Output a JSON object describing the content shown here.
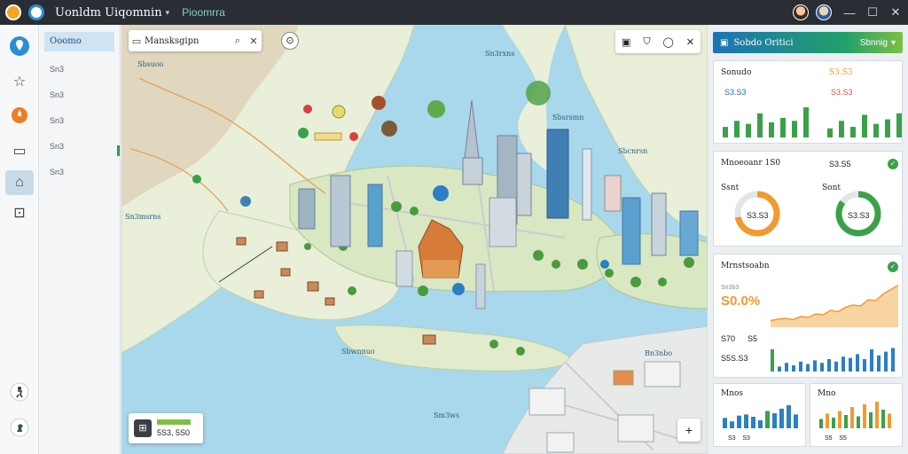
{
  "titlebar": {
    "app_title": "Uonldm Uiqomnin",
    "caret": "▾",
    "subtitle": "Pioomrra",
    "minimize": "—",
    "maximize": "☐",
    "close": "✕"
  },
  "sidebar": {
    "header": "Ooomo",
    "items": [
      "Sn3",
      "Sn3",
      "Sn3",
      "Sn3",
      "Sn3"
    ],
    "rail_icons": [
      "map-pin-icon",
      "star-icon",
      "flame-icon",
      "message-icon",
      "home-icon",
      "chart-icon",
      "person-icon",
      "chess-icon"
    ]
  },
  "map": {
    "search_value": "Mansksgipn",
    "search_icon": "⌕",
    "search_close": "✕",
    "compass": "⊙",
    "tools": [
      "▣",
      "⛉",
      "◯",
      "✕"
    ],
    "info_card_value": "5S3, 5S0",
    "zoom_symbol": "+",
    "labels": [
      "Sbsuoo",
      "Sn3rxns",
      "Sbsrsmn",
      "Sbcnrsn",
      "Sn3msrns",
      "Sbwnnuo",
      "Bn3nbo",
      "Sm3ws"
    ]
  },
  "panel": {
    "header_title": "Sobdo Oritici",
    "header_right": "Sbnnig",
    "card1": {
      "title_left": "Sonudo",
      "value_left": "S3.S3",
      "title_right": "S3.S3",
      "value_right": "S3.S3",
      "bars_left": [
        0.35,
        0.55,
        0.45,
        0.8,
        0.5,
        0.65,
        0.55,
        1.0
      ],
      "bars_right": [
        0.3,
        0.55,
        0.35,
        0.75,
        0.45,
        0.6,
        0.8,
        0.7
      ]
    },
    "card2": {
      "title": "Mnoeoanr 1S0",
      "value": "S3.S5",
      "donut1_label": "Ssnt",
      "donut1_value": "S3.S3",
      "donut1_fill": 0.72,
      "donut2_label": "Sont",
      "donut2_value": "S3.S3",
      "donut2_fill": 0.85
    },
    "card3": {
      "title": "Mrnstsoabn",
      "metric_label": "Sn3b3",
      "metric_value": "S0.0%",
      "row1_left": "S70",
      "row1_right": "S5",
      "row2": "S5S.S3",
      "line_values": [
        0.15,
        0.18,
        0.2,
        0.17,
        0.24,
        0.22,
        0.3,
        0.28,
        0.38,
        0.35,
        0.45,
        0.5,
        0.48,
        0.62,
        0.6,
        0.75,
        0.85,
        0.95
      ],
      "bars": [
        0.9,
        0.2,
        0.35,
        0.25,
        0.4,
        0.3,
        0.45,
        0.35,
        0.5,
        0.4,
        0.6,
        0.55,
        0.7,
        0.5,
        0.9,
        0.65,
        0.8,
        0.95
      ]
    },
    "card4": {
      "title": "Mnos",
      "footer": "S3    S3",
      "bars": [
        0.45,
        0.3,
        0.55,
        0.6,
        0.5,
        0.35,
        0.75,
        0.65,
        0.85,
        1.0,
        0.6
      ]
    },
    "card5": {
      "title": "Mno",
      "footer": "S5    S5",
      "bars": [
        0.35,
        0.55,
        0.4,
        0.65,
        0.5,
        0.8,
        0.45,
        0.9,
        0.6,
        1.0,
        0.7,
        0.55
      ]
    }
  },
  "colors": {
    "accent_green": "#3aa14a",
    "accent_orange": "#f29a2e",
    "accent_blue": "#2a7fc5",
    "water": "#a9d7ec",
    "land": "#e8efd8"
  }
}
